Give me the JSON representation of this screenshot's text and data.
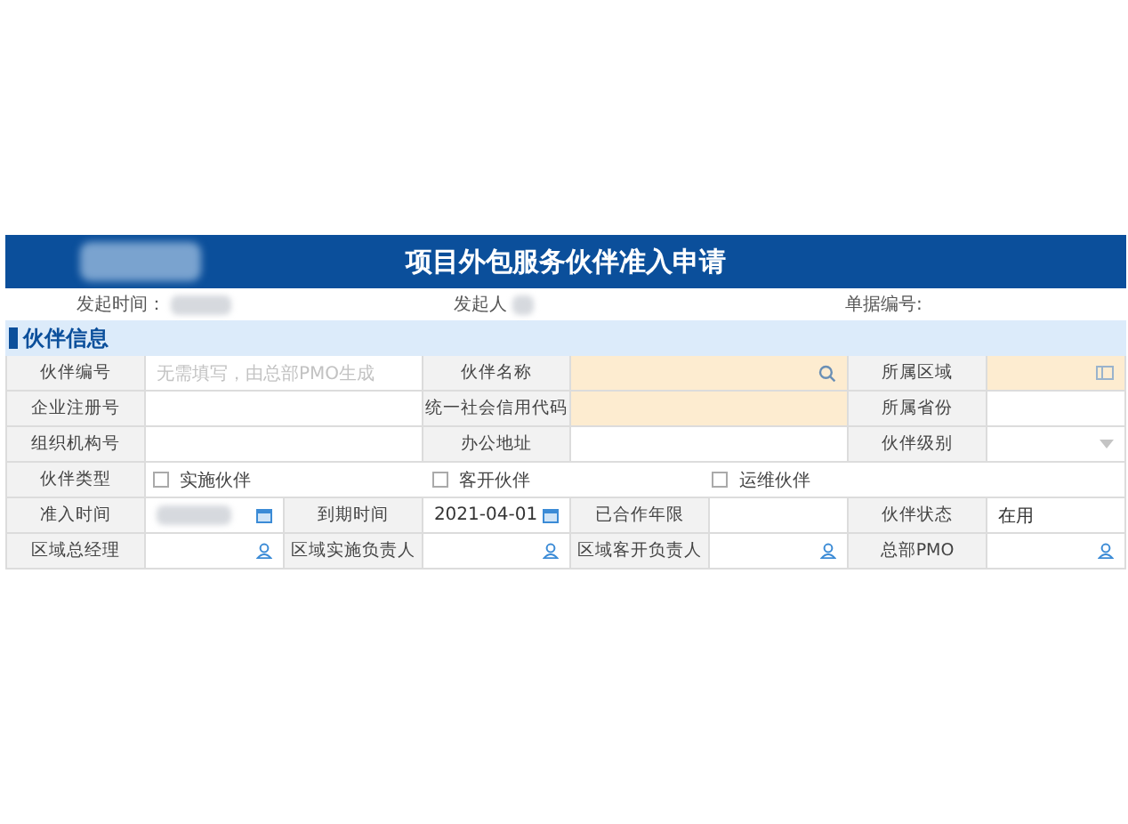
{
  "title": "项目外包服务伙伴准入申请",
  "meta": [
    {
      "label": "发起时间：",
      "redacted": true
    },
    {
      "label": "发起人",
      "redacted": true
    },
    {
      "label": "单据编号:"
    }
  ],
  "section": {
    "title": "伙伴信息"
  },
  "rows": [
    [
      {
        "kind": "label",
        "text": "伙伴编号"
      },
      {
        "kind": "text",
        "placeholder": "无需填写，由总部PMO生成",
        "required": false
      },
      {
        "kind": "label",
        "text": "伙伴名称"
      },
      {
        "kind": "lookup",
        "required": true
      },
      {
        "kind": "label",
        "text": "所属区域"
      },
      {
        "kind": "picker",
        "required": true
      }
    ],
    [
      {
        "kind": "label",
        "text": "企业注册号"
      },
      {
        "kind": "text",
        "required": false
      },
      {
        "kind": "label",
        "text": "统一社会信用代码"
      },
      {
        "kind": "text",
        "required": true
      },
      {
        "kind": "label",
        "text": "所属省份"
      },
      {
        "kind": "text",
        "required": false
      }
    ],
    [
      {
        "kind": "label",
        "text": "组织机构号"
      },
      {
        "kind": "text",
        "required": false
      },
      {
        "kind": "label",
        "text": "办公地址"
      },
      {
        "kind": "text",
        "required": false
      },
      {
        "kind": "label",
        "text": "伙伴级别"
      },
      {
        "kind": "select",
        "required": false
      }
    ],
    [
      {
        "kind": "label",
        "text": "伙伴类型"
      },
      {
        "kind": "checks",
        "options": [
          {
            "label": "实施伙伴",
            "checked": false
          },
          {
            "label": "客开伙伴",
            "checked": false
          },
          {
            "label": "运维伙伴",
            "checked": false
          }
        ]
      }
    ],
    [
      {
        "kind": "label",
        "text": "准入时间"
      },
      {
        "kind": "date",
        "redacted": true,
        "required": false
      },
      {
        "kind": "label",
        "text": "到期时间"
      },
      {
        "kind": "date",
        "value": "2021-04-01",
        "required": false
      },
      {
        "kind": "label",
        "text": "已合作年限"
      },
      {
        "kind": "text",
        "required": false
      },
      {
        "kind": "label",
        "text": "伙伴状态"
      },
      {
        "kind": "text",
        "value": "在用",
        "required": false
      }
    ],
    [
      {
        "kind": "label",
        "text": "区域总经理"
      },
      {
        "kind": "user",
        "required": false
      },
      {
        "kind": "label",
        "text": "区域实施负责人"
      },
      {
        "kind": "user",
        "required": false
      },
      {
        "kind": "label",
        "text": "区域客开负责人"
      },
      {
        "kind": "user",
        "required": false
      },
      {
        "kind": "label",
        "text": "总部PMO"
      },
      {
        "kind": "user",
        "required": false
      }
    ]
  ]
}
